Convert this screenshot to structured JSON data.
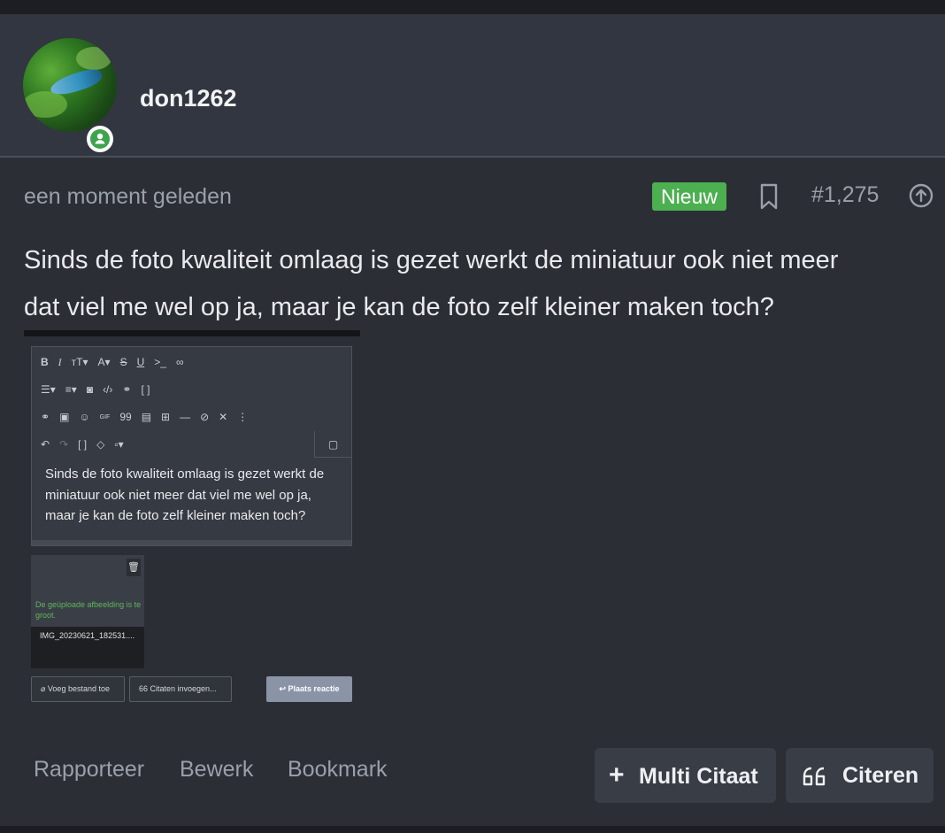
{
  "user": {
    "name": "don1262",
    "status": "online"
  },
  "post": {
    "time": "een moment geleden",
    "badge": "Nieuw",
    "number": "#1,275",
    "lines": [
      "Sinds de foto kwaliteit omlaag is gezet werkt de miniatuur ook niet meer",
      "dat viel me wel op ja, maar je kan de foto zelf kleiner maken toch?"
    ]
  },
  "screenshot": {
    "toolbar_row1": [
      "B",
      "I",
      "тT▾",
      "A▾",
      "S",
      "U",
      ">_",
      "∞"
    ],
    "editor_text_lines": [
      "Sinds de foto kwaliteit omlaag is gezet werkt de",
      "miniatuur ook niet meer dat viel me wel op ja,",
      "maar je kan de foto zelf kleiner maken toch?"
    ],
    "upload_error": "De geüploade afbeelding is te groot.",
    "upload_filename": "IMG_20230621_182531....",
    "attach_label": "Voeg bestand toe",
    "quotes_label": "Citaten invoegen...",
    "post_reply_label": "Plaats reactie"
  },
  "actions": {
    "report": "Rapporteer",
    "edit": "Bewerk",
    "bookmark": "Bookmark",
    "multiquote": "Multi Citaat",
    "quote": "Citeren"
  },
  "colors": {
    "accent_new": "#4caf50",
    "background": "#2b2e35",
    "header": "#323640"
  }
}
